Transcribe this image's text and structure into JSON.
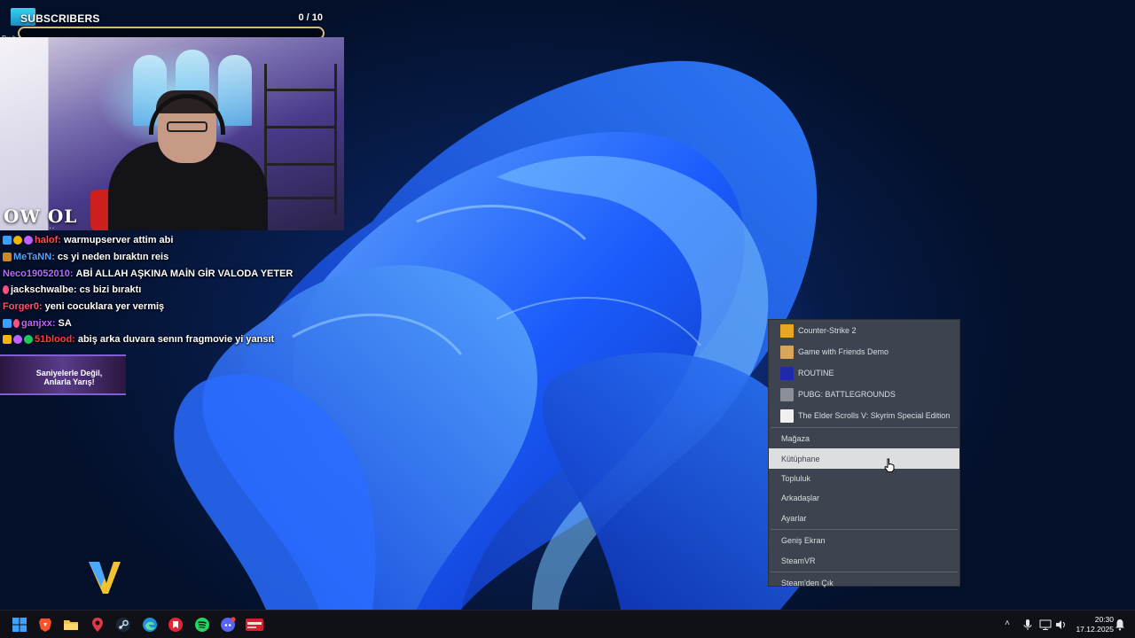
{
  "stream": {
    "subscriber_goal": {
      "title": "SUBSCRIBERS",
      "count": "0  / 10",
      "progress_fraction": 0,
      "tag": "Bu h"
    },
    "webcam": {
      "logo": "OW OL"
    },
    "chat": {
      "clipped_line": "……",
      "messages": [
        {
          "name": "halof:",
          "text": "warmupserver attim abi",
          "color": "#ff4f4f"
        },
        {
          "name": "MeTaNN:",
          "text": "cs yi neden bıraktın reis",
          "color": "#4fa3ff"
        },
        {
          "name": "Neco19052010:",
          "text": "ABİ ALLAH AŞKINA MAİN GİR VALODA YETER",
          "color": "#b36bff"
        },
        {
          "name": "jackschwalbe:",
          "text": "cs bizi bıraktı",
          "color": "#ffffff"
        },
        {
          "name": "Forger0:",
          "text": "yeni cocuklara yer vermiş",
          "color": "#ff4f6f"
        },
        {
          "name": "ganjxx:",
          "text": "SA",
          "color": "#c060ff"
        },
        {
          "name": "51blood:",
          "text": "abiş arka duvara senın fragmovie yi yansıt",
          "color": "#ff3b3b"
        }
      ]
    },
    "promo": {
      "line1": "Saniyelerle Değil,",
      "line2": "Anlarla Yarış!"
    }
  },
  "steam_menu": {
    "games": [
      {
        "label": "Counter-Strike 2",
        "icon": "cs2-icon",
        "color": "#e8a623"
      },
      {
        "label": "Game with Friends Demo",
        "icon": "gwf-icon",
        "color": "#d9a55a"
      },
      {
        "label": "ROUTINE",
        "icon": "routine-icon",
        "color": "#1e2aa8"
      },
      {
        "label": "PUBG: BATTLEGROUNDS",
        "icon": "pubg-icon",
        "color": "#8a8f98"
      },
      {
        "label": "The Elder Scrolls V: Skyrim Special Edition",
        "icon": "skyrim-icon",
        "color": "#f0f0f0"
      }
    ],
    "store": "Mağaza",
    "library": "Kütüphane",
    "community": "Topluluk",
    "friends": "Arkadaşlar",
    "settings": "Ayarlar",
    "big_picture": "Geniş Ekran",
    "steamvr": "SteamVR",
    "exit": "Steam'den Çık"
  },
  "taskbar": {
    "pinned": [
      "windows-start-icon",
      "brave-icon",
      "file-explorer-icon",
      "riot-client-icon",
      "steam-icon",
      "edge-icon",
      "red-app-icon",
      "spotify-icon",
      "discord-icon",
      "streamer-app-icon"
    ],
    "clock": {
      "time": "20:30",
      "date": "17.12.2025"
    }
  }
}
